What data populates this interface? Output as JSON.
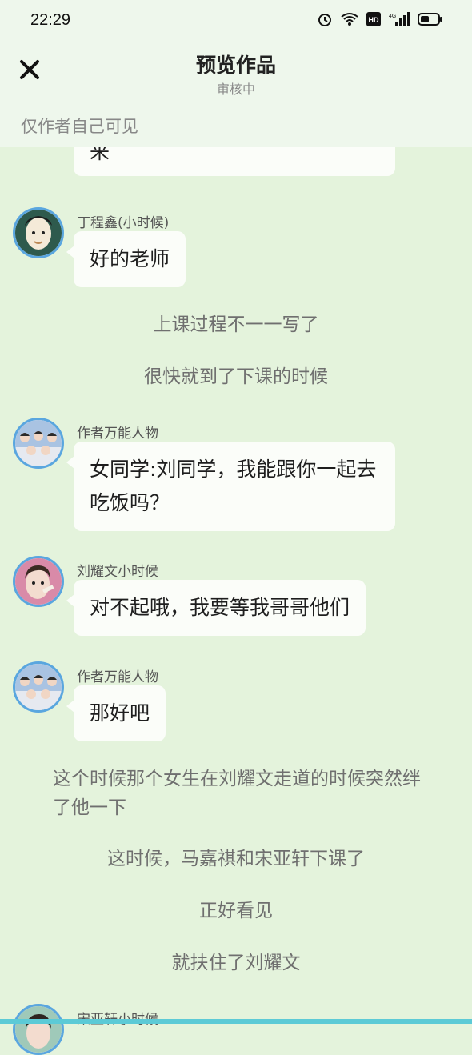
{
  "status": {
    "time": "22:29",
    "icons": [
      "alarm-icon",
      "wifi-icon",
      "hd-icon",
      "signal-4g-icon",
      "battery-icon"
    ]
  },
  "header": {
    "close_icon": "close-icon",
    "title": "预览作品",
    "subtitle": "审核中",
    "visibility_note": "仅作者自己可见"
  },
  "feed": {
    "partial_bubble_text": "来",
    "items": [
      {
        "type": "dialog",
        "speaker": "丁程鑫(小时候)",
        "text": "好的老师",
        "avatar": "avatar-dingchengxin"
      },
      {
        "type": "narration",
        "text": "上课过程不一一写了"
      },
      {
        "type": "narration",
        "text": "很快就到了下课的时候"
      },
      {
        "type": "dialog",
        "speaker": "作者万能人物",
        "text": "女同学:刘同学，我能跟你一起去吃饭吗？",
        "avatar": "avatar-author-group"
      },
      {
        "type": "dialog",
        "speaker": "刘耀文小时候",
        "text": "对不起哦，我要等我哥哥他们",
        "avatar": "avatar-liuyaowen"
      },
      {
        "type": "dialog",
        "speaker": "作者万能人物",
        "text": "那好吧",
        "avatar": "avatar-author-group"
      },
      {
        "type": "narration",
        "text": "这个时候那个女生在刘耀文走道的时候突然绊了他一下"
      },
      {
        "type": "narration",
        "text": "这时候，马嘉祺和宋亚轩下课了"
      },
      {
        "type": "narration",
        "text": "正好看见"
      },
      {
        "type": "narration",
        "text": "就扶住了刘耀文"
      },
      {
        "type": "dialog",
        "speaker": "宋亚轩小时候",
        "text": "",
        "avatar": "avatar-songyaxuan"
      }
    ]
  }
}
